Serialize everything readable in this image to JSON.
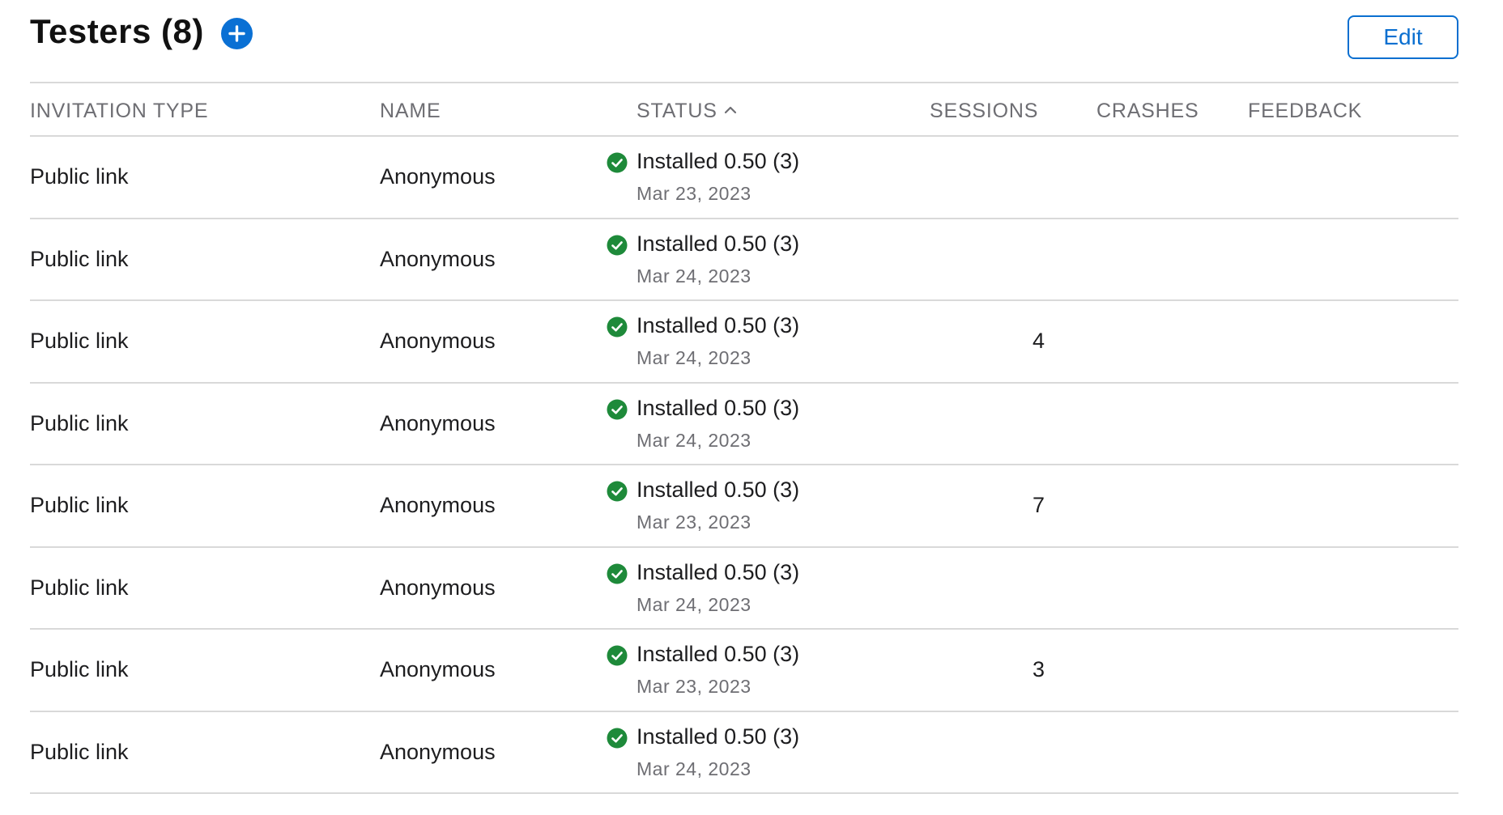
{
  "header": {
    "title": "Testers (8)",
    "add_icon": "plus-circle-icon",
    "edit_label": "Edit",
    "accent_color": "#0a70d4"
  },
  "table": {
    "columns": {
      "invitation_type": "INVITATION TYPE",
      "name": "NAME",
      "status": "STATUS",
      "sessions": "SESSIONS",
      "crashes": "CRASHES",
      "feedback": "FEEDBACK"
    },
    "sort_icon": "chevron-up-icon",
    "status_icon": "check-circle-icon",
    "status_color": "#1e8a3a",
    "rows": [
      {
        "invitation_type": "Public link",
        "name": "Anonymous",
        "status": "Installed 0.50 (3)",
        "date": "Mar 23, 2023",
        "sessions": "",
        "crashes": "",
        "feedback": ""
      },
      {
        "invitation_type": "Public link",
        "name": "Anonymous",
        "status": "Installed 0.50 (3)",
        "date": "Mar 24, 2023",
        "sessions": "",
        "crashes": "",
        "feedback": ""
      },
      {
        "invitation_type": "Public link",
        "name": "Anonymous",
        "status": "Installed 0.50 (3)",
        "date": "Mar 24, 2023",
        "sessions": "4",
        "crashes": "",
        "feedback": ""
      },
      {
        "invitation_type": "Public link",
        "name": "Anonymous",
        "status": "Installed 0.50 (3)",
        "date": "Mar 24, 2023",
        "sessions": "",
        "crashes": "",
        "feedback": ""
      },
      {
        "invitation_type": "Public link",
        "name": "Anonymous",
        "status": "Installed 0.50 (3)",
        "date": "Mar 23, 2023",
        "sessions": "7",
        "crashes": "",
        "feedback": ""
      },
      {
        "invitation_type": "Public link",
        "name": "Anonymous",
        "status": "Installed 0.50 (3)",
        "date": "Mar 24, 2023",
        "sessions": "",
        "crashes": "",
        "feedback": ""
      },
      {
        "invitation_type": "Public link",
        "name": "Anonymous",
        "status": "Installed 0.50 (3)",
        "date": "Mar 23, 2023",
        "sessions": "3",
        "crashes": "",
        "feedback": ""
      },
      {
        "invitation_type": "Public link",
        "name": "Anonymous",
        "status": "Installed 0.50 (3)",
        "date": "Mar 24, 2023",
        "sessions": "",
        "crashes": "",
        "feedback": ""
      }
    ]
  }
}
